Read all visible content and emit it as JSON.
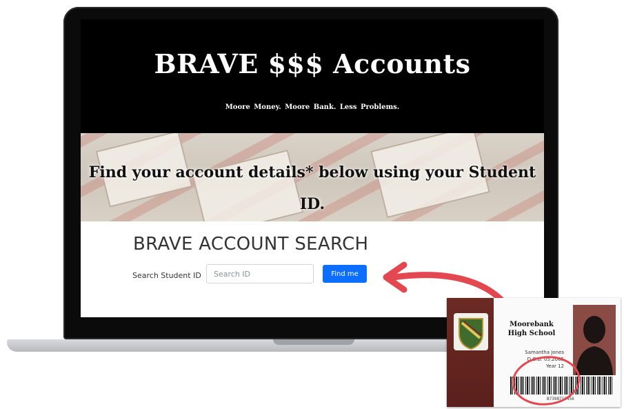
{
  "site": {
    "title": "BRAVE $$$ Accounts",
    "tagline": "Moore Money.   Moore Bank.   Less Problems."
  },
  "banner": {
    "text": "Find your account details* below using your Student ID."
  },
  "search": {
    "heading": "BRAVE ACCOUNT SEARCH",
    "label": "Search Student ID",
    "placeholder": "Search ID",
    "button_label": "Find me"
  },
  "id_card": {
    "school_line1": "Moorebank",
    "school_line2": "High School",
    "student_name": "Samantha Jones",
    "dob": "D.O.B: 05.2005",
    "year": "Year 12",
    "barcode_number": "B7398713456"
  },
  "colors": {
    "button": "#0d6efd",
    "arrow": "#e3474f",
    "id_card_accent": "#6b2a24"
  }
}
